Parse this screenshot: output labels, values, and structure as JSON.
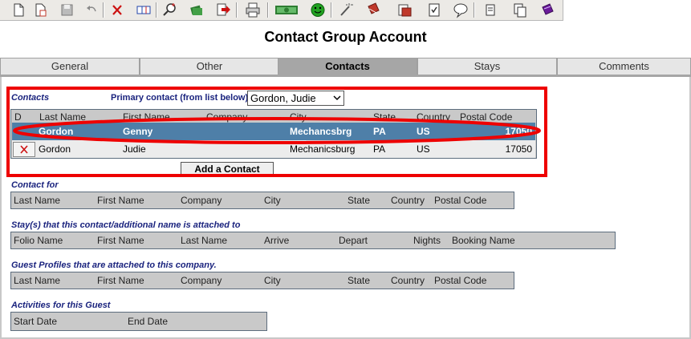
{
  "toolbar": {
    "buttons": [
      {
        "name": "new-document-icon",
        "color": "#3a3a3a"
      },
      {
        "name": "new-copy-icon",
        "color": "#c0392b"
      },
      {
        "name": "save-disk-icon",
        "color": "#777777"
      },
      {
        "name": "undo-icon",
        "color": "#888888"
      },
      {
        "name": "delete-x-icon",
        "color": "#cc1111"
      },
      {
        "name": "columns-icon",
        "color": "#2244aa"
      },
      {
        "name": "zoom-search-icon",
        "color": "#cc2222"
      },
      {
        "name": "money-stack-icon",
        "color": "#2e7d32"
      },
      {
        "name": "red-arrow-document-icon",
        "color": "#cc1111"
      },
      {
        "name": "print-icon",
        "color": "#444444"
      },
      {
        "name": "cash-bill-icon",
        "color": "#2e7d32"
      },
      {
        "name": "smiley-face-icon",
        "color": "#21a121"
      },
      {
        "name": "magic-wand-icon",
        "color": "#555555"
      },
      {
        "name": "red-book-icon",
        "color": "#c0392b"
      },
      {
        "name": "doc-stack-icon",
        "color": "#c0392b"
      },
      {
        "name": "checklist-icon",
        "color": "#333333"
      },
      {
        "name": "speech-bubble-icon",
        "color": "#333333"
      },
      {
        "name": "scroll-icon",
        "color": "#333333"
      },
      {
        "name": "copy-pages-icon",
        "color": "#333333"
      },
      {
        "name": "purple-book-icon",
        "color": "#6a1b9a"
      }
    ]
  },
  "page": {
    "title": "Contact Group Account"
  },
  "tabs": [
    {
      "label": "General",
      "active": false
    },
    {
      "label": "Other",
      "active": false
    },
    {
      "label": "Contacts",
      "active": true
    },
    {
      "label": "Stays",
      "active": false
    },
    {
      "label": "Comments",
      "active": false
    }
  ],
  "contacts": {
    "title": "Contacts",
    "primary_label": "Primary contact (from list below)",
    "primary_value": "Gordon, Judie",
    "columns": [
      "D",
      "Last Name",
      "First Name",
      "Company",
      "City",
      "State",
      "Country",
      "Postal Code"
    ],
    "rows": [
      {
        "d": "",
        "last": "Gordon",
        "first": "Genny",
        "company": "",
        "city": "Mechancsbrg",
        "state": "PA",
        "country": "US",
        "postal": "17050",
        "selected": true
      },
      {
        "d": "",
        "last": "Gordon",
        "first": "Judie",
        "company": "",
        "city": "Mechanicsburg",
        "state": "PA",
        "country": "US",
        "postal": "17050",
        "selected": false
      }
    ],
    "add_button": "Add a Contact"
  },
  "contact_for": {
    "title": "Contact for",
    "columns": [
      "Last Name",
      "First Name",
      "Company",
      "City",
      "State",
      "Country",
      "Postal Code"
    ]
  },
  "stays_attached": {
    "title": "Stay(s) that this contact/additional name is attached to",
    "columns": [
      "Folio Name",
      "First Name",
      "Last Name",
      "Arrive",
      "Depart",
      "Nights",
      "Booking Name"
    ]
  },
  "guest_profiles": {
    "title": "Guest Profiles that are attached to this company.",
    "columns": [
      "Last Name",
      "First Name",
      "Company",
      "City",
      "State",
      "Country",
      "Postal Code"
    ]
  },
  "activities": {
    "title": "Activities for this Guest",
    "columns": [
      "Start Date",
      "End Date"
    ]
  },
  "colors": {
    "selected_row": "#4e7fa8",
    "highlight_red": "#ee0000",
    "section_title": "#1a237e",
    "active_tab": "#a6a6a6"
  }
}
